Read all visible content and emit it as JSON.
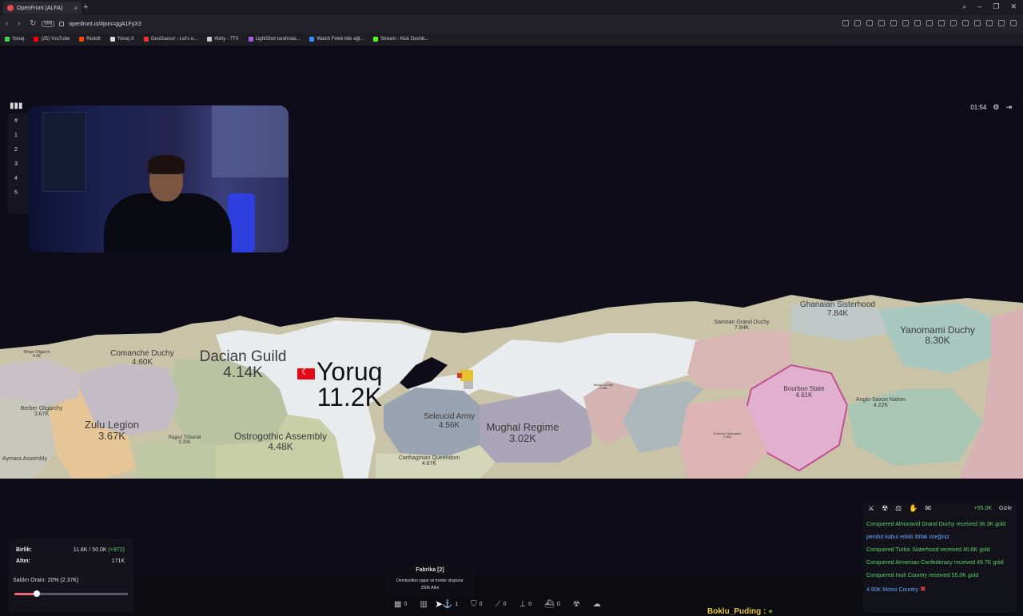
{
  "browser": {
    "tab_title": "OpenFront (ALFA)",
    "tab_close": "×",
    "new_tab": "+",
    "url": "openfront.io/#join=ggA1FyX3",
    "vpn": "VPN",
    "bookmarks": [
      "Yoruq",
      "(25) YouTube",
      "Reddit",
      "Yoruq X",
      "GeoGuessr - Let's e...",
      "Ifishy - 7TV",
      "LightShot tarafında...",
      "Watch Felek bile ağl...",
      "Stream - Kick Dashb..."
    ]
  },
  "game": {
    "timer": "01:54",
    "leaderboard_header": "#",
    "leaderboard_rows": [
      "1",
      "2",
      "3",
      "4",
      "5"
    ],
    "player": {
      "name": "Yoruq",
      "troops": "11.2K"
    },
    "territories": [
      {
        "name": "Dacian Guild",
        "troops": "4.14K"
      },
      {
        "name": "Comanche Duchy",
        "troops": "4.60K"
      },
      {
        "name": "Zulu Legion",
        "troops": "3.67K"
      },
      {
        "name": "Ostrogothic Assembly",
        "troops": "4.48K"
      },
      {
        "name": "Seleucid Army",
        "troops": "4.56K"
      },
      {
        "name": "Mughal Regime",
        "troops": "3.02K"
      },
      {
        "name": "Ghanaian Sisterhood",
        "troops": "7.84K"
      },
      {
        "name": "Yanomami Duchy",
        "troops": "8.30K"
      },
      {
        "name": "Samoan Grand Duchy",
        "troops": "7.94K"
      },
      {
        "name": "Bourbon State",
        "troops": "4.61K"
      },
      {
        "name": "Anglo-Saxon Nation",
        "troops": "4.22K"
      },
      {
        "name": "Berber Oligarchy",
        "troops": "3.67K"
      },
      {
        "name": "Rajput Tribunal",
        "troops": "3.30K"
      },
      {
        "name": "Carthaginian Queendom",
        "troops": "4.67K"
      },
      {
        "name": "Bingo Oligarch",
        "troops": "4.6K"
      },
      {
        "name": "Mossi County",
        "troops": "2.38K"
      },
      {
        "name": "Chibcha Federation",
        "troops": "2.38K"
      },
      {
        "name": "Aymara Assembly",
        "troops": ""
      }
    ],
    "stats": {
      "troops_label": "Birlik:",
      "troops_value": "11.8K / 50.0K",
      "troops_delta": "(+972)",
      "gold_label": "Altın:",
      "gold_value": "171K",
      "attack_ratio_label": "Saldırı Oranı: 20% (2.37K)",
      "attack_ratio": 0.2
    },
    "tooltip": {
      "title": "Fabrika [2]",
      "desc": "Demiryolları yapar ve trenler oluşturur",
      "cost": "250K Altın"
    },
    "build_counts": [
      "0",
      "",
      "1",
      "0",
      "0",
      "0",
      "0"
    ],
    "messages_panel": {
      "gold_income": "+55.0K",
      "hide_label": "Gizle",
      "messages": [
        {
          "text": "Conquered Almoravid Grand Duchy received 36.3K gold",
          "color": "green"
        },
        {
          "text": "peridot kabul edildi ittifak isteğiniz",
          "color": "blue"
        },
        {
          "text": "Conquered Turkic Sisterhood received 40.8K gold",
          "color": "green"
        },
        {
          "text": "Conquered Armenian Confederacy received 49.7K gold",
          "color": "green"
        },
        {
          "text": "Conquered Inuit Country received 55.0K gold",
          "color": "green"
        },
        {
          "text": "4.90K Mossi Country",
          "color": "blue"
        }
      ]
    },
    "viewer_name": "Boklu_Puding :"
  },
  "colors": {
    "ocean": "#0e0c18",
    "player": "#e8ecef",
    "gold_text": "#5fd16a",
    "info_text": "#6aa6ff",
    "viewer": "#e8c63a"
  }
}
